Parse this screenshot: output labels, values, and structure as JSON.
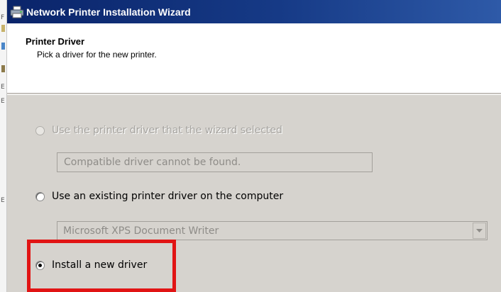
{
  "window": {
    "title": "Network Printer Installation Wizard",
    "icon": "printer-icon"
  },
  "header": {
    "title": "Printer Driver",
    "subtitle": "Pick a driver for the new printer."
  },
  "options": [
    {
      "label": "Use the printer driver that the wizard selected",
      "selected": false,
      "enabled": false
    },
    {
      "label": "Use an existing printer driver on the computer",
      "selected": false,
      "enabled": true
    },
    {
      "label": "Install a new driver",
      "selected": true,
      "enabled": true
    }
  ],
  "wizard_driver_field": {
    "value": "Compatible driver cannot be found."
  },
  "existing_driver_select": {
    "value": "Microsoft XPS Document Writer"
  },
  "highlight": {
    "color": "#e11414",
    "target": "Install a new driver"
  },
  "background_window": {
    "marks": [
      "F",
      "E",
      "E",
      "E"
    ]
  }
}
